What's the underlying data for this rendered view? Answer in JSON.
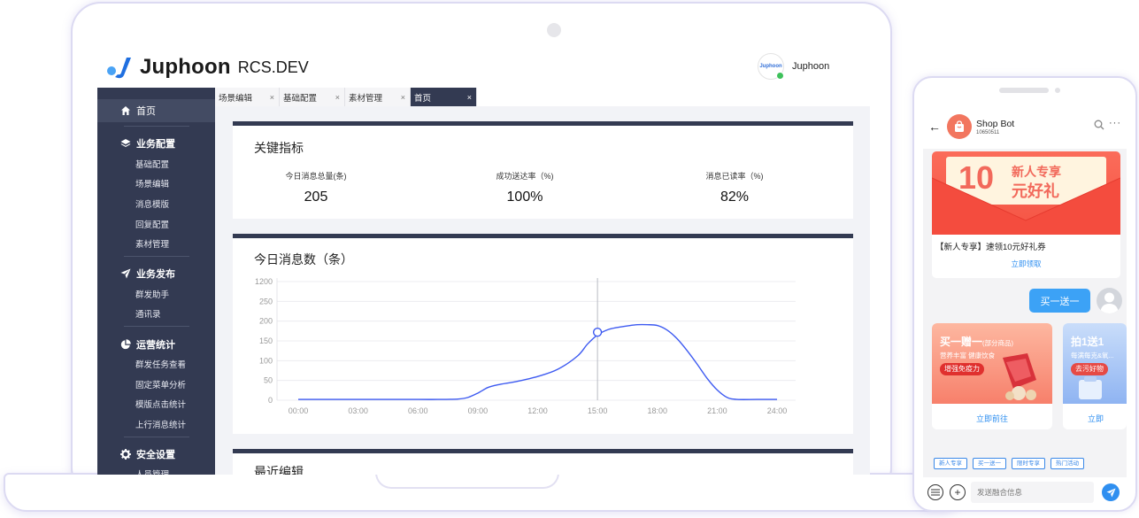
{
  "app": {
    "logo_text": "Juphoon",
    "logo_sub": "RCS.DEV",
    "user": {
      "avatar_text": "Juphoon",
      "name": "Juphoon"
    }
  },
  "sidebar": {
    "home": "首页",
    "groups": [
      {
        "title": "业务配置",
        "icon": "layers-icon",
        "items": [
          "基础配置",
          "场景编辑",
          "消息模版",
          "回复配置",
          "素材管理"
        ]
      },
      {
        "title": "业务发布",
        "icon": "send-icon",
        "items": [
          "群发助手",
          "通讯录"
        ]
      },
      {
        "title": "运营统计",
        "icon": "pie-chart-icon",
        "items": [
          "群发任务查看",
          "固定菜单分析",
          "模版点击统计",
          "上行消息统计"
        ]
      },
      {
        "title": "安全设置",
        "icon": "gear-icon",
        "items": [
          "人员管理"
        ]
      }
    ]
  },
  "tabs": [
    {
      "label": "场景编辑",
      "active": false
    },
    {
      "label": "基础配置",
      "active": false
    },
    {
      "label": "素材管理",
      "active": false
    },
    {
      "label": "首页",
      "active": true
    }
  ],
  "kpi_card": {
    "title": "关键指标",
    "metrics": [
      {
        "label": "今日消息总量(条)",
        "value": "205"
      },
      {
        "label": "成功送达率（%)",
        "value": "100%"
      },
      {
        "label": "消息已读率（%)",
        "value": "82%"
      }
    ]
  },
  "chart_card": {
    "title": "今日消息数（条）"
  },
  "recent_card": {
    "title": "最近编辑"
  },
  "chart_data": {
    "type": "line",
    "title": "今日消息数（条）",
    "xlabel": "",
    "ylabel": "",
    "y_tick_labels": [
      "0",
      "50",
      "100",
      "150",
      "200",
      "250",
      "1200"
    ],
    "x_tick_labels": [
      "00:00",
      "03:00",
      "06:00",
      "09:00",
      "12:00",
      "15:00",
      "18:00",
      "21:00",
      "24:00"
    ],
    "series": [
      {
        "color": "#3d5af1",
        "x": [
          0,
          3,
          6,
          7,
          8,
          8.5,
          9,
          9.5,
          10,
          11,
          12,
          13,
          14,
          14.5,
          15,
          15.5,
          16,
          16.5,
          17,
          17.5,
          18,
          18.5,
          19,
          19.5,
          20,
          20.5,
          21,
          21.5,
          22,
          23,
          24
        ],
        "y": [
          2,
          2,
          2,
          2,
          3,
          7,
          18,
          32,
          39,
          48,
          60,
          78,
          112,
          142,
          165,
          178,
          184,
          188,
          191,
          191,
          189,
          177,
          155,
          125,
          91,
          55,
          26,
          7,
          2,
          2,
          2
        ]
      }
    ],
    "highlight": {
      "x": 15,
      "y": 172
    },
    "grid": true
  },
  "phone": {
    "bot_name": "Shop Bot",
    "bot_number": "10650511",
    "coupon": {
      "amount": "10",
      "line1": "新人专享",
      "line2": "元好礼",
      "text": "【新人专享】速领10元好礼券",
      "link": "立即领取"
    },
    "user_message": "买一送一",
    "promos": [
      {
        "title": "买一赠一",
        "tag": "(部分商品)",
        "sub": "营养丰富  健康饮食",
        "button": "增强免疫力",
        "link": "立即前往"
      },
      {
        "title": "拍1送1",
        "sub": "每满每克&氧...",
        "button": "去污好物",
        "link": "立即"
      }
    ],
    "chips": [
      "新人专享",
      "买一送一",
      "限时专享",
      "热门活动"
    ],
    "input_placeholder": "发送融合信息"
  }
}
